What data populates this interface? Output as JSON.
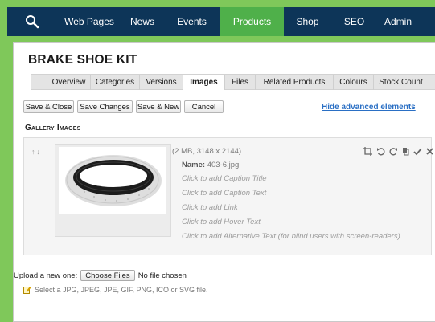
{
  "topnav": {
    "items": [
      {
        "label": "Web Pages"
      },
      {
        "label": "News"
      },
      {
        "label": "Events"
      },
      {
        "label": "Products"
      },
      {
        "label": "Shop"
      },
      {
        "label": "SEO"
      },
      {
        "label": "Admin"
      }
    ],
    "active_index": 3,
    "active_color": "#4fb04a",
    "bar_color": "#0d3558"
  },
  "page": {
    "title": "BRAKE SHOE KIT"
  },
  "tabs": [
    {
      "label": "Overview"
    },
    {
      "label": "Categories"
    },
    {
      "label": "Versions"
    },
    {
      "label": "Images"
    },
    {
      "label": "Files"
    },
    {
      "label": "Related Products"
    },
    {
      "label": "Colours"
    },
    {
      "label": "Stock Count"
    }
  ],
  "active_tab_index": 3,
  "toolbar": {
    "save_close": "Save & Close",
    "save_changes": "Save Changes",
    "save_new": "Save & New",
    "cancel": "Cancel",
    "hide_advanced": "Hide advanced elements"
  },
  "gallery": {
    "heading": "Gallery Images",
    "item": {
      "arrows": "↑↓",
      "size_info": "(2 MB, 3148 x 2144)",
      "name_label": "Name:",
      "name_value": "403-6.jpg",
      "caption_title": "Click to add Caption Title",
      "caption_text": "Click to add Caption Text",
      "link": "Click to add Link",
      "hover_text": "Click to add Hover Text",
      "alt_text": "Click to add Alternative Text (for blind users with screen-readers)"
    }
  },
  "upload": {
    "label": "Upload a new one:",
    "button": "Choose Files",
    "status": "No file chosen",
    "hint": "Select a JPG, JPEG, JPE, GIF, PNG, ICO or SVG file."
  },
  "colors": {
    "link": "#2a6fc4",
    "page_border": "#7fc85a"
  }
}
